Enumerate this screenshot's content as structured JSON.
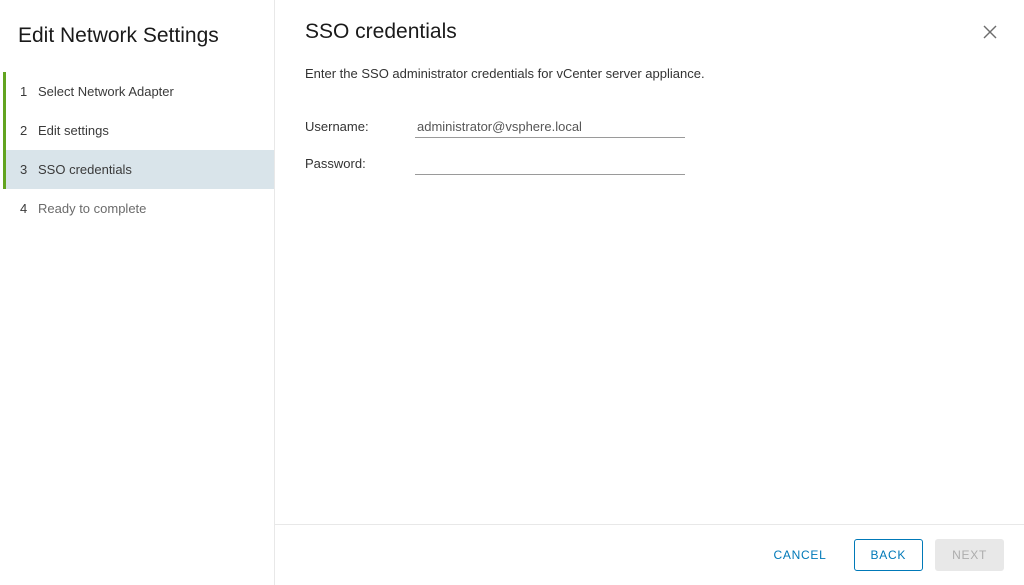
{
  "wizard": {
    "title": "Edit Network Settings",
    "steps": [
      {
        "num": "1",
        "label": "Select Network Adapter",
        "state": "completed"
      },
      {
        "num": "2",
        "label": "Edit settings",
        "state": "completed"
      },
      {
        "num": "3",
        "label": "SSO credentials",
        "state": "active"
      },
      {
        "num": "4",
        "label": "Ready to complete",
        "state": "pending"
      }
    ]
  },
  "main": {
    "title": "SSO credentials",
    "instruction": "Enter the SSO administrator credentials for vCenter server appliance.",
    "username_label": "Username:",
    "username_value": "administrator@vsphere.local",
    "password_label": "Password:",
    "password_value": ""
  },
  "footer": {
    "cancel": "CANCEL",
    "back": "BACK",
    "next": "NEXT"
  }
}
